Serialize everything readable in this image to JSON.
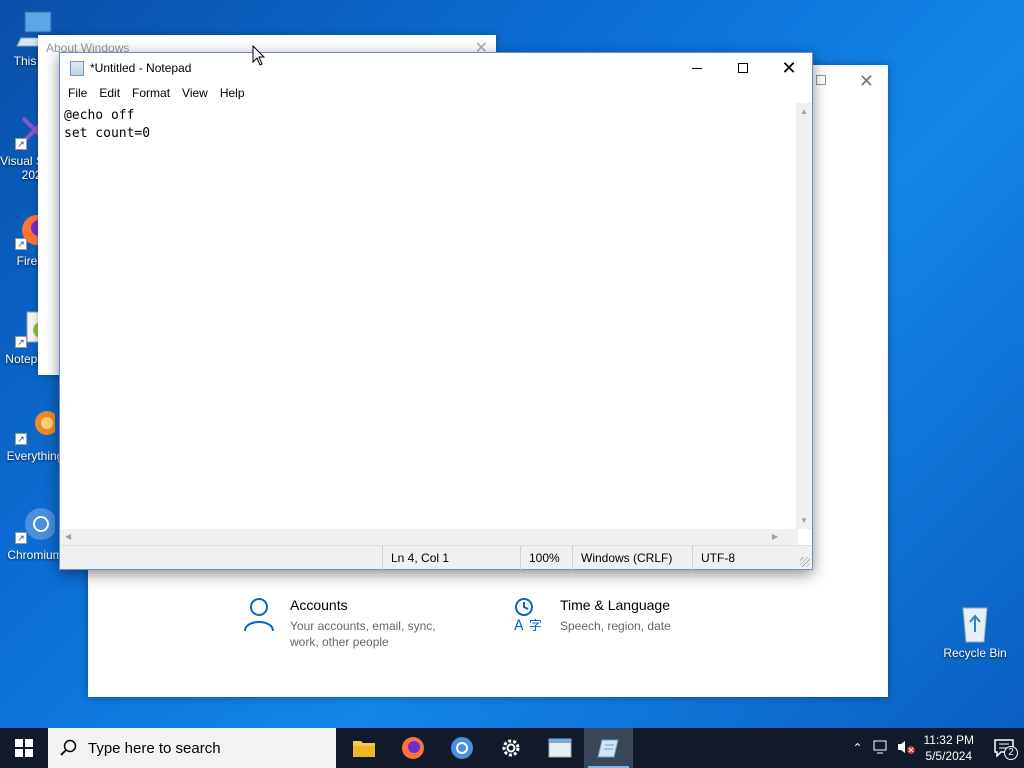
{
  "desktop": {
    "icons": [
      {
        "label": "This PC"
      },
      {
        "label": "Visual Studio 2022"
      },
      {
        "label": "Firefox"
      },
      {
        "label": "Notepad++"
      },
      {
        "label": "Everything"
      },
      {
        "label": "Chromium"
      },
      {
        "label": "Recycle Bin"
      }
    ]
  },
  "about_window": {
    "title": "About Windows"
  },
  "settings_window": {
    "categories": [
      {
        "title": "Accounts",
        "desc": "Your accounts, email, sync, work, other people"
      },
      {
        "title": "Time & Language",
        "desc": "Speech, region, date"
      }
    ]
  },
  "notepad": {
    "title": "*Untitled - Notepad",
    "menu": [
      "File",
      "Edit",
      "Format",
      "View",
      "Help"
    ],
    "content": "@echo off\nset count=0",
    "status": {
      "position": "Ln 4, Col 1",
      "zoom": "100%",
      "line_ending": "Windows (CRLF)",
      "encoding": "UTF-8"
    }
  },
  "taskbar": {
    "search_placeholder": "Type here to search",
    "time": "11:32 PM",
    "date": "5/5/2024",
    "notification_count": "2"
  }
}
